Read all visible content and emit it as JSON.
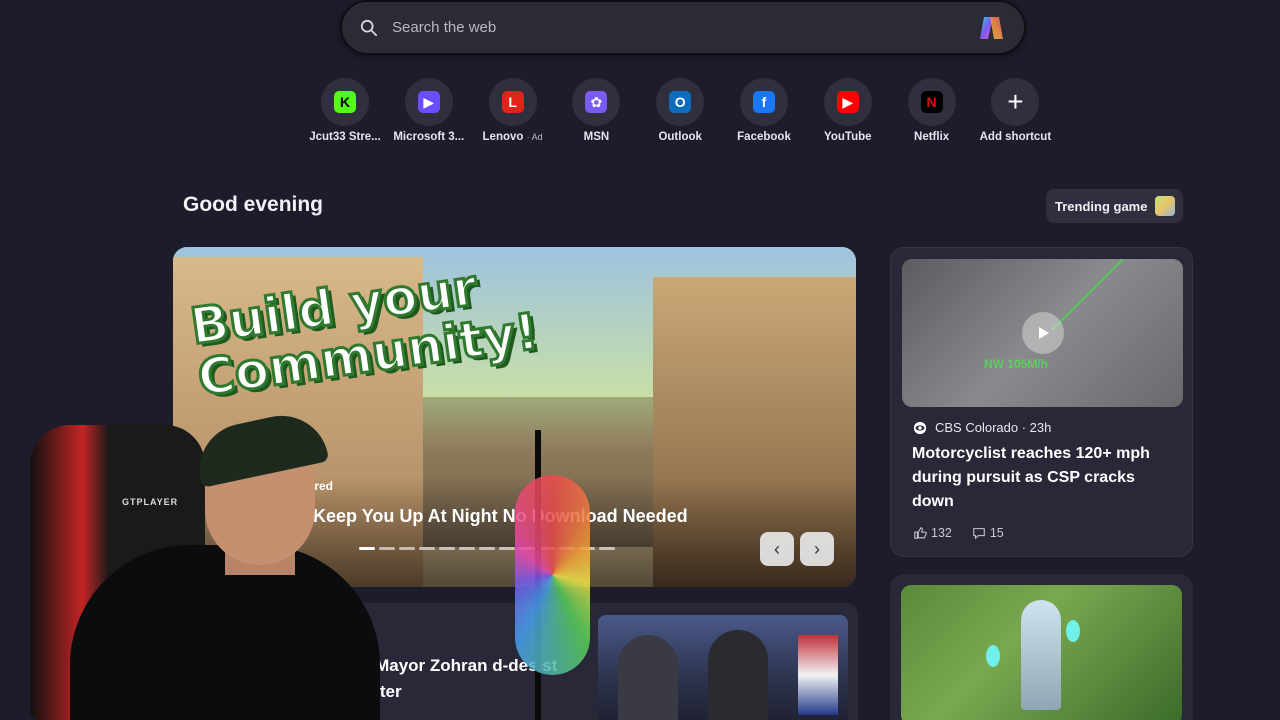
{
  "search": {
    "placeholder": "Search the web"
  },
  "shortcuts": [
    {
      "label": "Jcut33 Stre...",
      "icon": "kick-icon",
      "color": "#53fc18",
      "glyph": "K",
      "glyph_color": "#000000"
    },
    {
      "label": "Microsoft 3...",
      "icon": "microsoft365-icon",
      "color": "#6b4cff",
      "glyph": "▶",
      "glyph_color": "#ffffff"
    },
    {
      "label": "Lenovo",
      "ad": "· Ad",
      "icon": "lenovo-icon",
      "color": "#e2231a",
      "glyph": "L",
      "glyph_color": "#ffffff"
    },
    {
      "label": "MSN",
      "icon": "msn-icon",
      "color": "#7a5af0",
      "glyph": "✿",
      "glyph_color": "#ffffff"
    },
    {
      "label": "Outlook",
      "icon": "outlook-icon",
      "color": "#0f6cbd",
      "glyph": "O",
      "glyph_color": "#ffffff"
    },
    {
      "label": "Facebook",
      "icon": "facebook-icon",
      "color": "#1877f2",
      "glyph": "f",
      "glyph_color": "#ffffff"
    },
    {
      "label": "YouTube",
      "icon": "youtube-icon",
      "color": "#ff0000",
      "glyph": "▶",
      "glyph_color": "#ffffff"
    },
    {
      "label": "Netflix",
      "icon": "netflix-icon",
      "color": "#000000",
      "glyph": "N",
      "glyph_color": "#e50914"
    },
    {
      "label": "Add shortcut",
      "icon": "plus-icon",
      "color": "transparent",
      "glyph": "+",
      "glyph_color": "#ffffff"
    }
  ],
  "greeting": "Good evening",
  "trending": {
    "label": "Trending game"
  },
  "hero": {
    "banner_line1": "Build your",
    "banner_line2": "Community!",
    "sponsored": "nsored",
    "title": "ill Keep You Up At Night No Download Needed",
    "dots_total": 13,
    "dots_active": 0,
    "prev": "‹",
    "next": "›"
  },
  "news": {
    "overlay_speed": "NW  105M/h",
    "source": "CBS Colorado · 23h",
    "headline": "Motorcyclist reaches 120+ mph during pursuit as CSP cracks down",
    "likes": "132",
    "comments": "15"
  },
  "lower_news": {
    "headline": "o Mayor Zohran d-desist letter"
  },
  "webcam": {
    "chair_brand": "GTPLAYER"
  },
  "colors": {
    "background": "#1d1c2b",
    "card": "#282838"
  }
}
